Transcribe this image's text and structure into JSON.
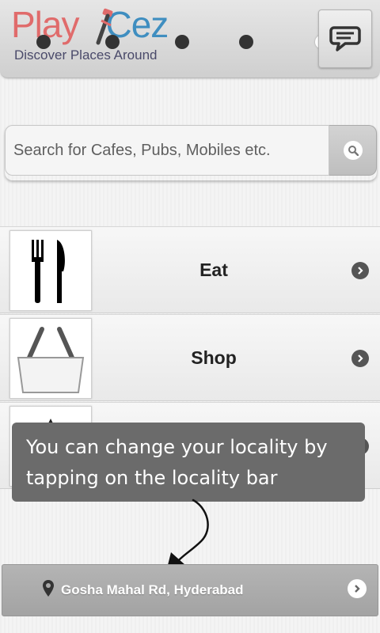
{
  "header": {
    "logo_play": "Play",
    "logo_cez": "Cez",
    "tagline": "Discover Places Around",
    "chat_icon": "chat-bubble-icon",
    "page_indicator": {
      "count": 5,
      "active_index": 4
    }
  },
  "search": {
    "placeholder": "Search for Cafes, Pubs, Mobiles etc.",
    "icon": "search-icon"
  },
  "categories": [
    {
      "label": "Eat",
      "icon": "fork-knife-icon"
    },
    {
      "label": "Shop",
      "icon": "shopping-basket-icon"
    },
    {
      "label": "",
      "icon": "category-icon"
    }
  ],
  "tooltip": {
    "text": "You can change your locality by tapping on the locality bar"
  },
  "locality": {
    "label": "Gosha Mahal Rd, Hyderabad",
    "icon": "location-pin-icon"
  },
  "colors": {
    "logo_red": "#e06b6b",
    "logo_blue": "#3f8ec0",
    "tooltip_bg": "#6b6b6b",
    "locality_bg": "#a9a9a9"
  }
}
